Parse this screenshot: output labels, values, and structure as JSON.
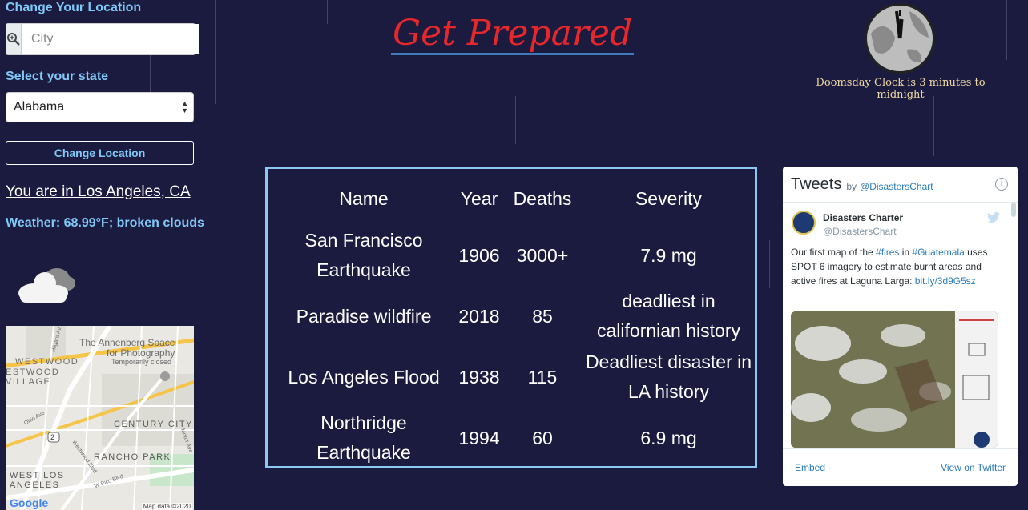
{
  "location_form": {
    "change_label": "Change Your Location",
    "city_placeholder": "City",
    "state_label": "Select your state",
    "state_value": "Alabama",
    "change_button": "Change Location"
  },
  "status": {
    "location_text": "You are in Los Angeles, CA",
    "weather_text": "Weather: 68.99°F; broken clouds",
    "weather_icon": "broken-clouds-icon"
  },
  "map": {
    "labels": {
      "annenberg": "The Annenberg Space",
      "annenberg2": "for Photography",
      "annenberg3": "Temporarily closed",
      "westwood": "WESTWOOD",
      "westwood_village1": "ESTWOOD",
      "westwood_village2": "VILLAGE",
      "century_city": "CENTURY CITY",
      "rancho_park": "RANCHO PARK",
      "west_la1": "WEST LOS",
      "west_la2": "ANGELES",
      "google": "Google",
      "map_data": "Map data ©2020",
      "road_hilgard": "Hilgard Av",
      "road_ohio": "Ohio Ave",
      "road_westwood": "Westwood Blvd",
      "road_pico": "W Pico Blvd",
      "road_motor": "Motor Ave",
      "shield": "2"
    }
  },
  "header": {
    "title": "Get Prepared",
    "clock_caption": "Doomsday Clock is 3 minutes to midnight"
  },
  "disasters": {
    "headers": [
      "Name",
      "Year",
      "Deaths",
      "Severity"
    ],
    "rows": [
      {
        "name": [
          "San Francisco",
          "Earthquake"
        ],
        "year": "1906",
        "deaths": "3000+",
        "severity": [
          "7.9 mg"
        ]
      },
      {
        "name": [
          "Paradise wildfire"
        ],
        "year": "2018",
        "deaths": "85",
        "severity": [
          "deadliest in",
          "californian history"
        ]
      },
      {
        "name": [
          "Los Angeles Flood"
        ],
        "year": "1938",
        "deaths": "115",
        "severity": [
          "Deadliest disaster in",
          "LA history"
        ]
      },
      {
        "name": [
          "Northridge",
          "Earthquake"
        ],
        "year": "1994",
        "deaths": "60",
        "severity": [
          "6.9 mg"
        ]
      }
    ]
  },
  "tweets": {
    "title": "Tweets",
    "by": "by",
    "handle": "@DisastersChart",
    "info": "i",
    "tweet": {
      "name": "Disasters Charter",
      "screen_name": "@DisastersChart",
      "text_1": "Our first map of the ",
      "link_fires": "#fires",
      "text_2": " in ",
      "link_guatemala": "#Guatemala",
      "text_3": " uses SPOT 6 imagery to estimate burnt areas and active fires at Laguna Larga: ",
      "link_url": "bit.ly/3d9G5sz"
    },
    "embed": "Embed",
    "view": "View on Twitter"
  }
}
